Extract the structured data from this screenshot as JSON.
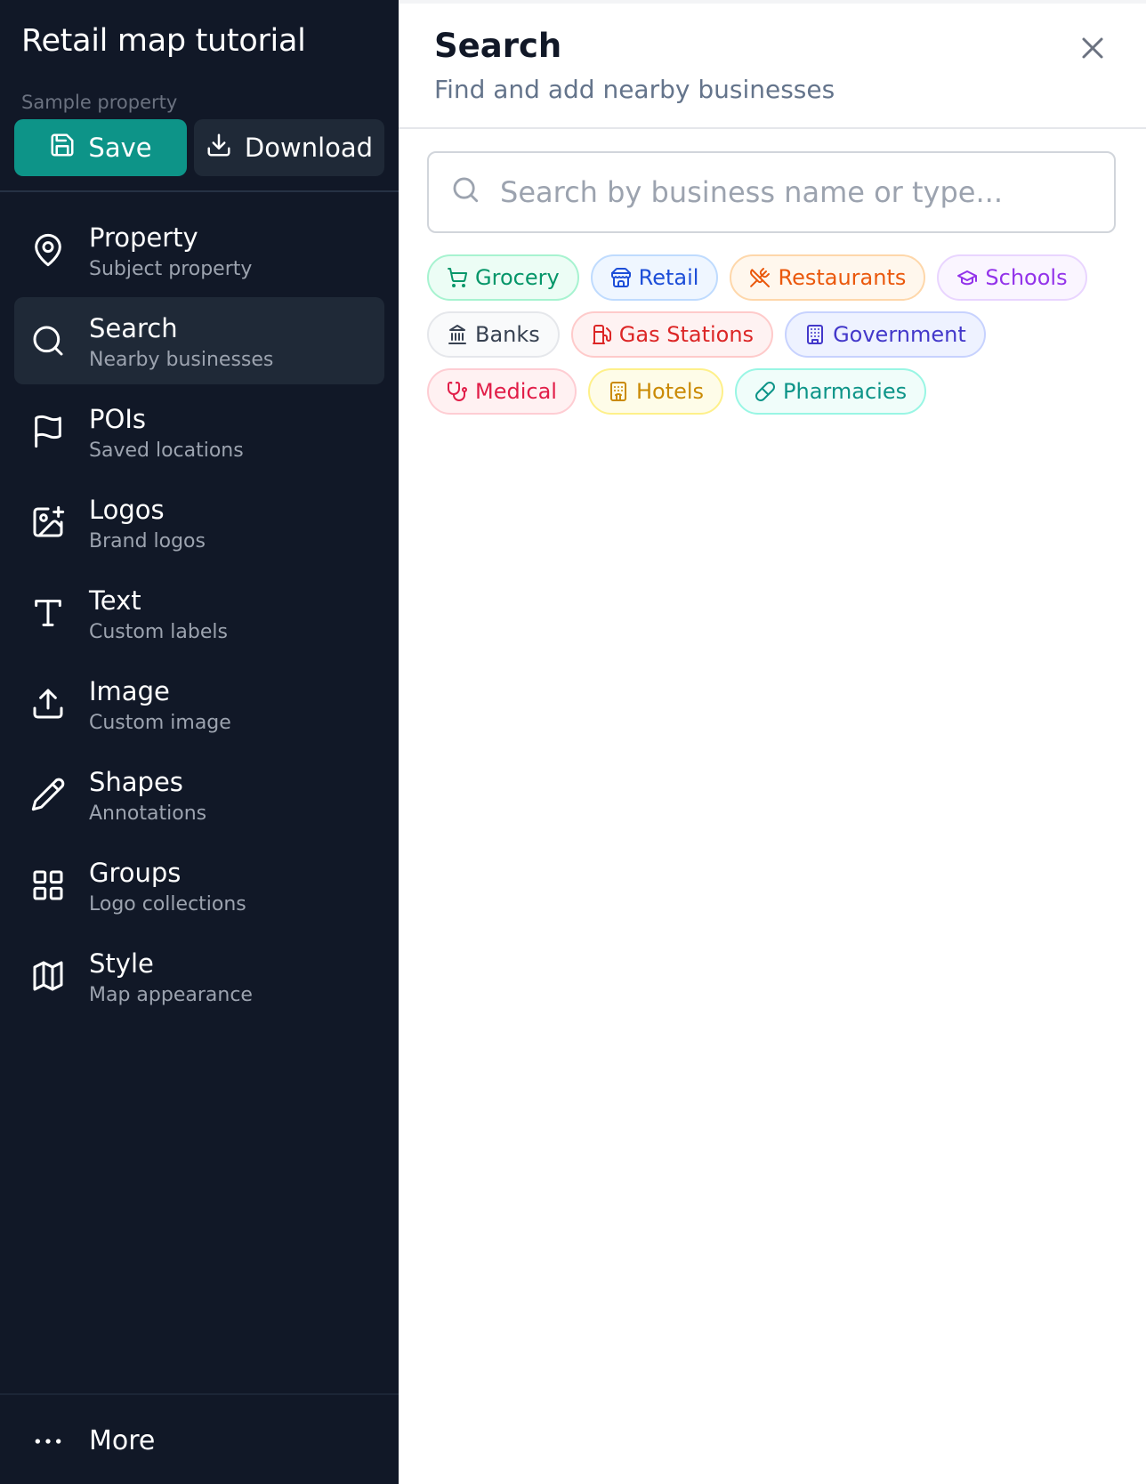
{
  "sidebar": {
    "title": "Retail map tutorial",
    "project_label": "Sample property",
    "save_label": "Save",
    "download_label": "Download",
    "items": [
      {
        "label": "Property",
        "sub": "Subject property",
        "icon": "map-pin-icon"
      },
      {
        "label": "Search",
        "sub": "Nearby businesses",
        "icon": "search-icon",
        "active": true
      },
      {
        "label": "POIs",
        "sub": "Saved locations",
        "icon": "flag-icon"
      },
      {
        "label": "Logos",
        "sub": "Brand logos",
        "icon": "image-plus-icon"
      },
      {
        "label": "Text",
        "sub": "Custom labels",
        "icon": "text-icon"
      },
      {
        "label": "Image",
        "sub": "Custom image",
        "icon": "upload-icon"
      },
      {
        "label": "Shapes",
        "sub": "Annotations",
        "icon": "pencil-icon"
      },
      {
        "label": "Groups",
        "sub": "Logo collections",
        "icon": "grid-icon"
      },
      {
        "label": "Style",
        "sub": "Map appearance",
        "icon": "map-icon"
      }
    ],
    "more_label": "More"
  },
  "panel": {
    "title": "Search",
    "subtitle": "Find and add nearby businesses",
    "search_placeholder": "Search by business name or type...",
    "search_value": "",
    "categories": [
      {
        "label": "Grocery",
        "icon": "shopping-cart-icon",
        "color": "#059669",
        "bg": "#ecfdf5",
        "border": "#a7f3d0"
      },
      {
        "label": "Retail",
        "icon": "store-icon",
        "color": "#1d4ed8",
        "bg": "#eff6ff",
        "border": "#bfdbfe"
      },
      {
        "label": "Restaurants",
        "icon": "utensils-icon",
        "color": "#ea580c",
        "bg": "#fff7ed",
        "border": "#fed7aa"
      },
      {
        "label": "Schools",
        "icon": "graduation-cap-icon",
        "color": "#9333ea",
        "bg": "#faf5ff",
        "border": "#e9d5ff"
      },
      {
        "label": "Banks",
        "icon": "bank-icon",
        "color": "#374151",
        "bg": "#f9fafb",
        "border": "#e5e7eb"
      },
      {
        "label": "Gas Stations",
        "icon": "fuel-icon",
        "color": "#dc2626",
        "bg": "#fef2f2",
        "border": "#fecaca"
      },
      {
        "label": "Government",
        "icon": "building-icon",
        "color": "#4338ca",
        "bg": "#eef2ff",
        "border": "#c7d2fe"
      },
      {
        "label": "Medical",
        "icon": "stethoscope-icon",
        "color": "#e11d48",
        "bg": "#fff1f2",
        "border": "#fecdd3"
      },
      {
        "label": "Hotels",
        "icon": "hotel-icon",
        "color": "#ca8a04",
        "bg": "#fefce8",
        "border": "#fef08a"
      },
      {
        "label": "Pharmacies",
        "icon": "pill-icon",
        "color": "#0d9488",
        "bg": "#f0fdfa",
        "border": "#99f6e4"
      }
    ]
  }
}
